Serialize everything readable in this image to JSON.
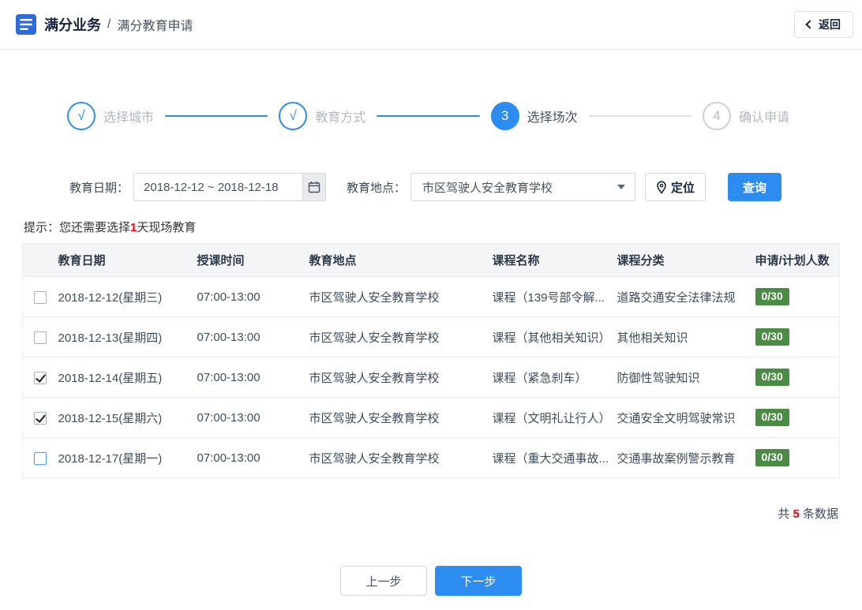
{
  "header": {
    "app_title": "满分业务",
    "separator": "/",
    "page_title": "满分教育申请",
    "back_label": "返回"
  },
  "steps": [
    {
      "label": "选择城市",
      "marker": "√",
      "done": true
    },
    {
      "label": "教育方式",
      "marker": "√",
      "done": true
    },
    {
      "label": "选择场次",
      "marker": "3",
      "active": true
    },
    {
      "label": "确认申请",
      "marker": "4",
      "pending": true
    }
  ],
  "filters": {
    "date_label": "教育日期：",
    "date_value": "2018-12-12 ~ 2018-12-18",
    "location_label": "教育地点：",
    "location_value": "市区驾驶人安全教育学校",
    "locate_label": "定位",
    "query_label": "查询"
  },
  "tip": {
    "prefix": "提示：您还需要选择",
    "highlight": "1",
    "suffix": "天现场教育"
  },
  "table": {
    "headers": [
      "教育日期",
      "授课时间",
      "教育地点",
      "课程名称",
      "课程分类",
      "申请/计划人数"
    ],
    "rows": [
      {
        "checked": false,
        "date": "2018-12-12(星期三)",
        "time": "07:00-13:00",
        "place": "市区驾驶人安全教育学校",
        "course": "课程（139号部令解...",
        "category": "道路交通安全法律法规",
        "count": "0/30"
      },
      {
        "checked": false,
        "date": "2018-12-13(星期四)",
        "time": "07:00-13:00",
        "place": "市区驾驶人安全教育学校",
        "course": "课程（其他相关知识）",
        "category": "其他相关知识",
        "count": "0/30"
      },
      {
        "checked": true,
        "date": "2018-12-14(星期五)",
        "time": "07:00-13:00",
        "place": "市区驾驶人安全教育学校",
        "course": "课程（紧急刹车）",
        "category": "防御性驾驶知识",
        "count": "0/30"
      },
      {
        "checked": true,
        "date": "2018-12-15(星期六)",
        "time": "07:00-13:00",
        "place": "市区驾驶人安全教育学校",
        "course": "课程（文明礼让行人）",
        "category": "交通安全文明驾驶常识",
        "count": "0/30"
      },
      {
        "checked": false,
        "active": true,
        "date": "2018-12-17(星期一)",
        "time": "07:00-13:00",
        "place": "市区驾驶人安全教育学校",
        "course": "课程（重大交通事故...",
        "category": "交通事故案例警示教育",
        "count": "0/30"
      }
    ]
  },
  "footer": {
    "total_prefix": "共 ",
    "total_count": "5",
    "total_suffix": " 条数据"
  },
  "actions": {
    "prev_label": "上一步",
    "next_label": "下一步"
  },
  "icons": {
    "app": "list-icon",
    "back": "chevron-left-icon",
    "calendar": "calendar-icon",
    "locate": "location-pin-icon",
    "select": "chevron-down-icon"
  },
  "colors": {
    "primary": "#2d8cf0",
    "badge_green": "#4a8c44",
    "highlight_red": "#e60012",
    "navy": "#17233d"
  }
}
